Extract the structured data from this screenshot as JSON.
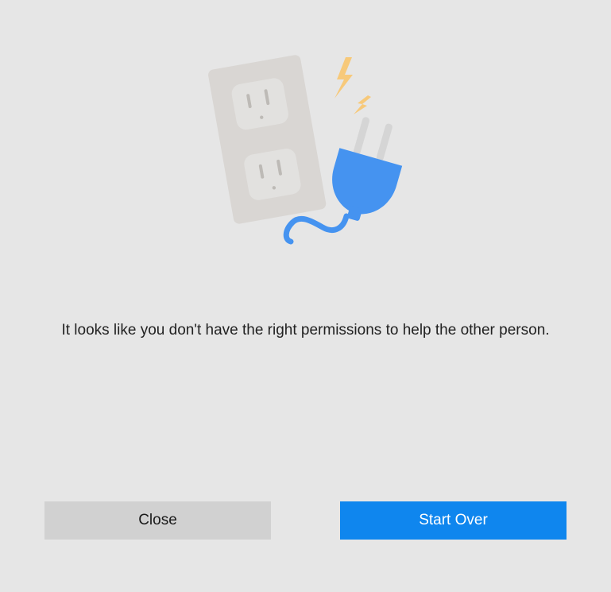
{
  "message": "It looks like you don't have the right permissions to help the other person.",
  "buttons": {
    "close_label": "Close",
    "start_over_label": "Start Over"
  },
  "illustration": {
    "icon": "unplugged-outlet-icon"
  },
  "colors": {
    "background": "#e6e6e6",
    "accent": "#0f86ee",
    "plug": "#4593f0",
    "spark": "#f7c97a",
    "outlet_plate": "#d9d6d3",
    "outlet_socket": "#e2e1df"
  }
}
